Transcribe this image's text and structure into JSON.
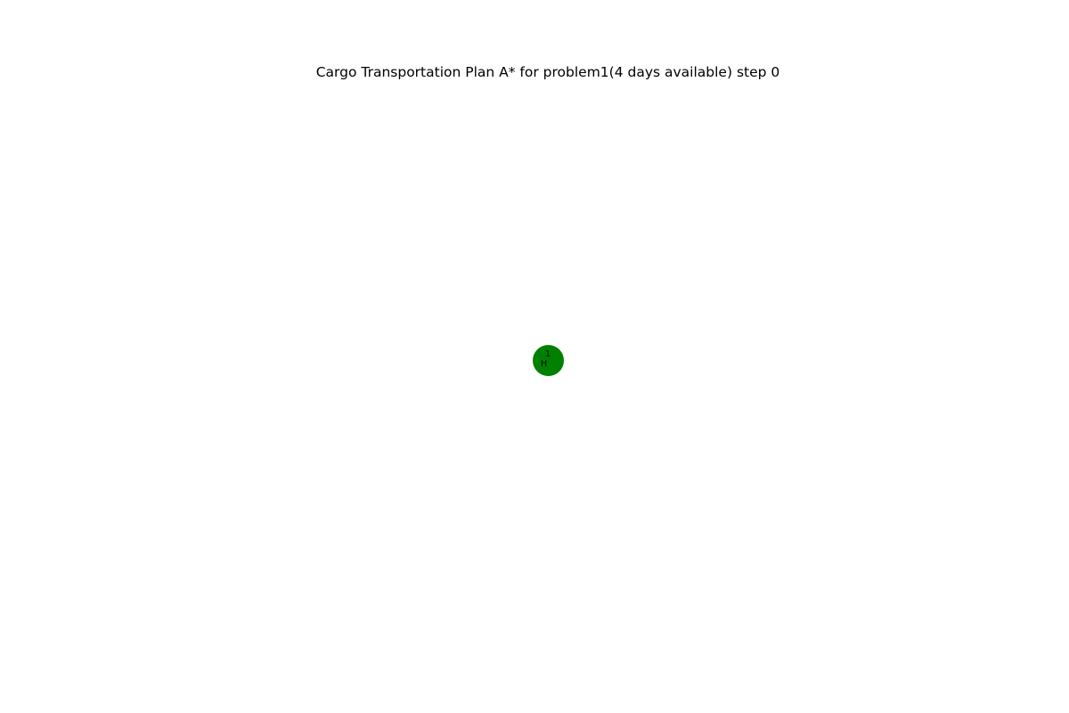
{
  "figure": {
    "title": "Cargo Transportation Plan A* for problem1(4 days available) step 0"
  },
  "nodes": [
    {
      "label_line1": "1",
      "label_line2": "H",
      "color": "#008000"
    }
  ]
}
